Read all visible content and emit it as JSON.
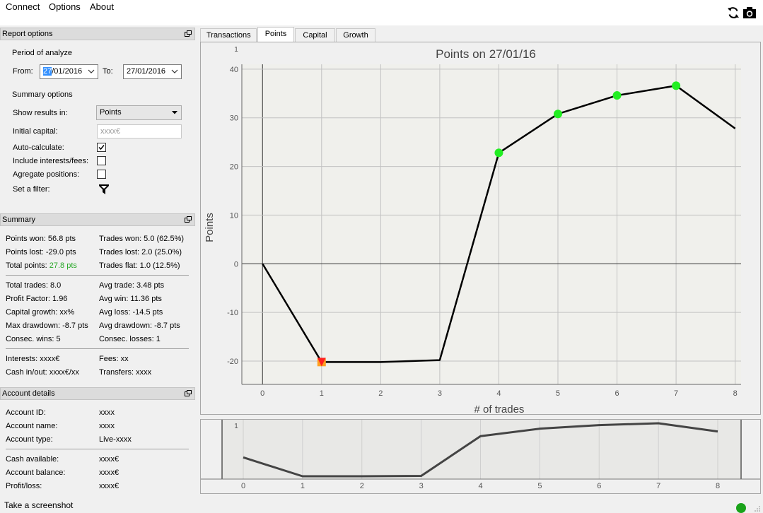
{
  "menu": {
    "connect": "Connect",
    "options": "Options",
    "about": "About"
  },
  "toolbar": {
    "refresh_icon": "refresh-icon",
    "camera_icon": "camera-icon"
  },
  "report": {
    "title": "Report options",
    "period_label": "Period of analyze",
    "from_label": "From:",
    "from_sel": "27",
    "from_rest": "/01/2016",
    "to_label": "To:",
    "to_value": "27/01/2016",
    "summary_options_label": "Summary options",
    "show_results_label": "Show results in:",
    "show_results_value": "Points",
    "initial_capital_label": "Initial capital:",
    "initial_capital_placeholder": "xxxx€",
    "auto_calc_label": "Auto-calculate:",
    "auto_calc_checked": true,
    "include_fees_label": "Include interests/fees:",
    "include_fees_checked": false,
    "aggregate_label": "Agregate positions:",
    "aggregate_checked": false,
    "filter_label": "Set a filter:"
  },
  "summary": {
    "title": "Summary",
    "points_won": "Points won: 56.8 pts",
    "points_lost": "Points lost: -29.0 pts",
    "total_points_label": "Total points: ",
    "total_points_value": "27.8 pts",
    "trades_won": "Trades won: 5.0 (62.5%)",
    "trades_lost": "Trades lost: 2.0 (25.0%)",
    "trades_flat": "Trades flat: 1.0 (12.5%)",
    "total_trades": "Total trades: 8.0",
    "profit_factor": "Profit Factor: 1.96",
    "capital_growth": "Capital growth: xx%",
    "max_drawdown": "Max drawdown: -8.7 pts",
    "consec_wins": "Consec. wins: 5",
    "avg_trade": "Avg trade: 3.48 pts",
    "avg_win": "Avg win: 11.36 pts",
    "avg_loss": "Avg loss: -14.5 pts",
    "avg_drawdown": "Avg drawdown: -8.7 pts",
    "consec_losses": "Consec. losses: 1",
    "interests": "Interests: xxxx€",
    "cash_inout": "Cash in/out: xxxx€/xx",
    "fees": "Fees: xx",
    "transfers": "Transfers: xxxx"
  },
  "account": {
    "title": "Account details",
    "id_label": "Account ID:",
    "id_value": "xxxx",
    "name_label": "Account name:",
    "name_value": "xxxx",
    "type_label": "Account type:",
    "type_value": "Live-xxxx",
    "cash_label": "Cash available:",
    "cash_value": "xxxx€",
    "balance_label": "Account balance:",
    "balance_value": "xxxx€",
    "pl_label": "Profit/loss:",
    "pl_value": "xxxx€"
  },
  "tabs": {
    "transactions": "Transactions",
    "points": "Points",
    "capital": "Capital",
    "growth": "Growth"
  },
  "status": {
    "text": "Take a screenshot",
    "indicator_color": "#1aa31a"
  },
  "chart_data": {
    "type": "line",
    "title": "Points on 27/01/16",
    "xlabel": "# of trades",
    "ylabel": "Points",
    "corner_label": "1",
    "x": [
      0,
      1,
      2,
      3,
      4,
      5,
      6,
      7,
      8
    ],
    "values": [
      0,
      -20.2,
      -20.2,
      -19.8,
      22.8,
      30.8,
      34.6,
      36.6,
      27.8
    ],
    "markers": [
      {
        "x": 1,
        "y": -20.2,
        "kind": "loss",
        "color": "#ff2020"
      },
      {
        "x": 4,
        "y": 22.8,
        "kind": "win",
        "color": "#22ee22"
      },
      {
        "x": 5,
        "y": 30.8,
        "kind": "win",
        "color": "#22ee22"
      },
      {
        "x": 6,
        "y": 34.6,
        "kind": "win",
        "color": "#22ee22"
      },
      {
        "x": 7,
        "y": 36.6,
        "kind": "win",
        "color": "#22ee22"
      }
    ],
    "xlim": [
      -0.35,
      8.1
    ],
    "ylim": [
      -24.8,
      41
    ],
    "xticks": [
      0,
      1,
      2,
      3,
      4,
      5,
      6,
      7,
      8
    ],
    "yticks": [
      -20,
      -10,
      0,
      10,
      20,
      30,
      40
    ],
    "grid": true
  }
}
